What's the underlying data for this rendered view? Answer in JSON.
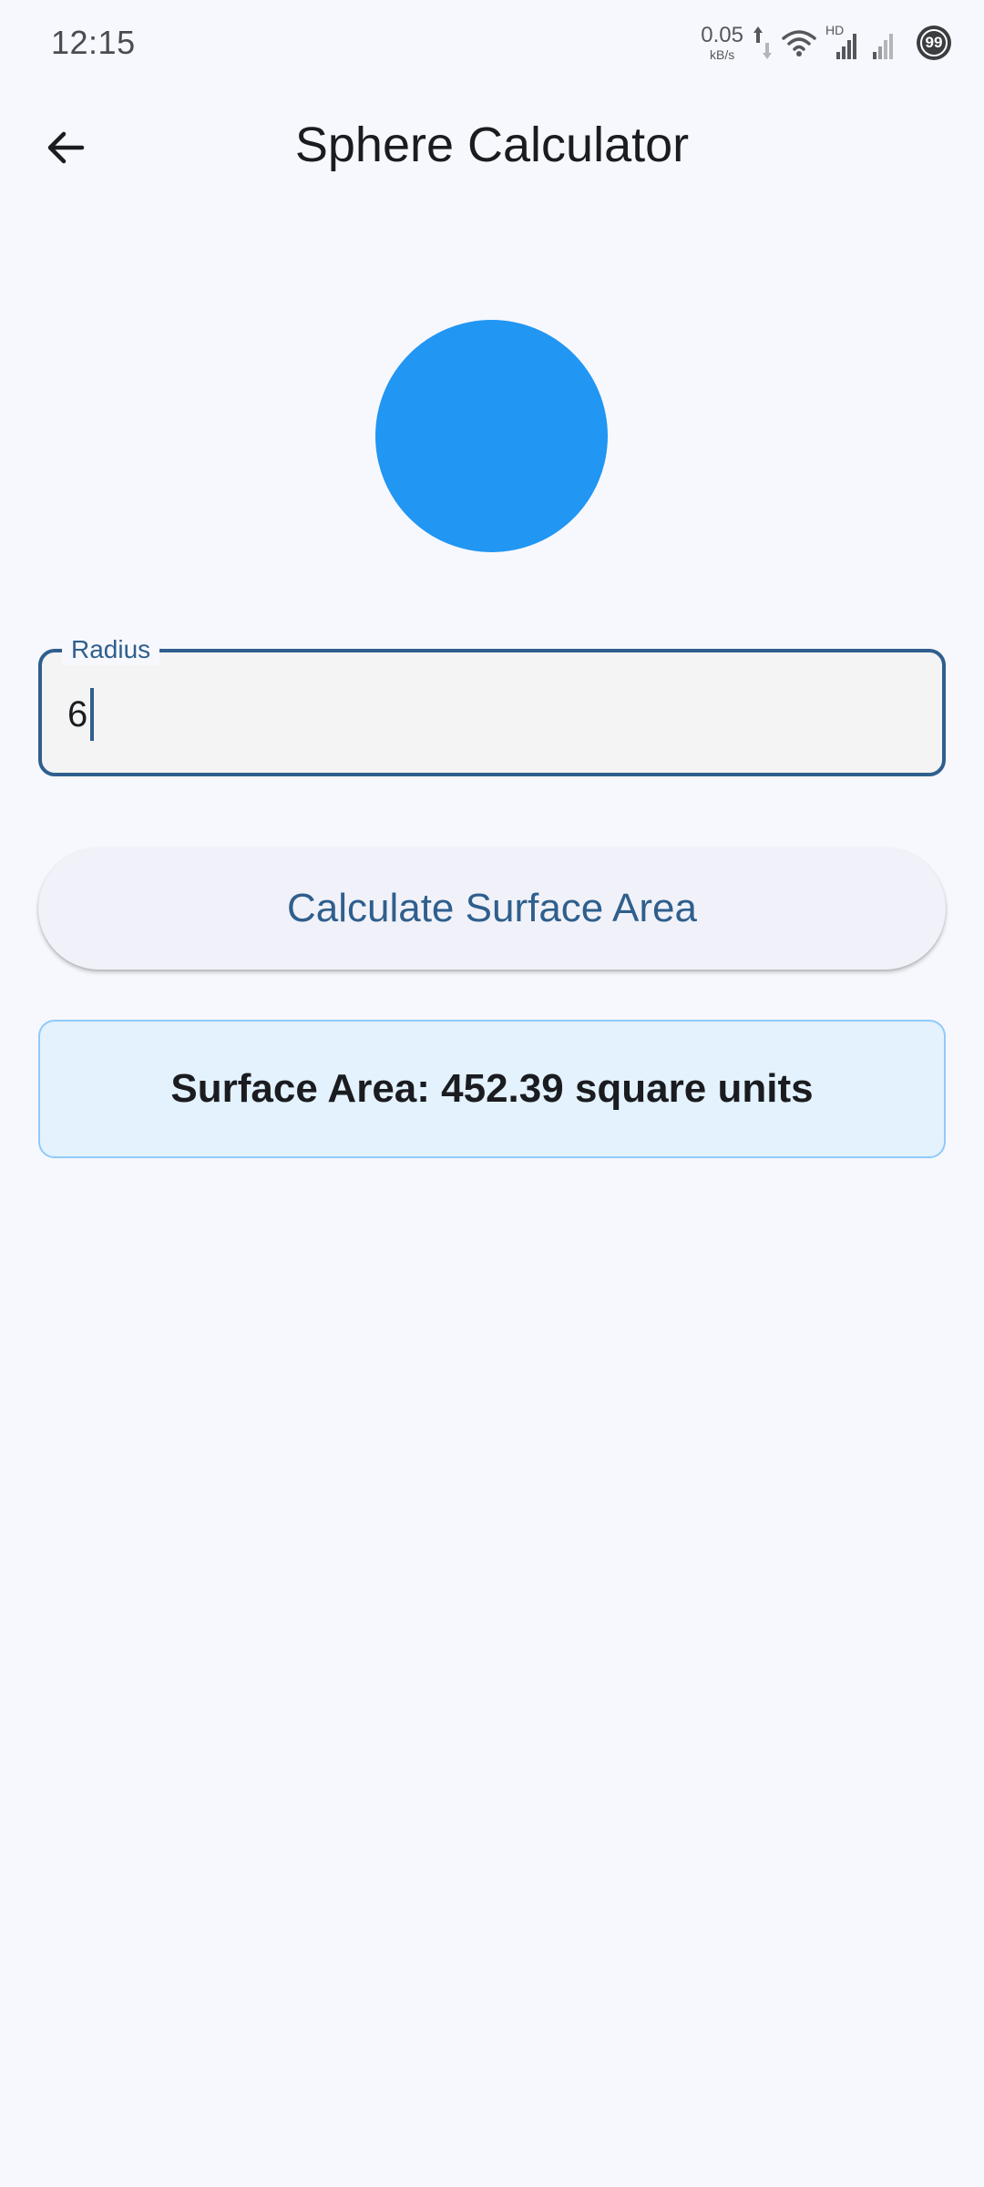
{
  "status_bar": {
    "time": "12:15",
    "net_speed_value": "0.05",
    "net_speed_unit": "kB/s",
    "hd_label": "HD",
    "battery": "99"
  },
  "app_bar": {
    "title": "Sphere Calculator",
    "back_icon": "arrow-back-icon"
  },
  "sphere": {
    "color": "#2196f3"
  },
  "radius_field": {
    "label": "Radius",
    "value": "6"
  },
  "calculate_button": {
    "label": "Calculate Surface Area"
  },
  "result": {
    "text": "Surface Area: 452.39 square units"
  },
  "colors": {
    "background": "#f7f8fd",
    "primary": "#2f5f8d",
    "result_bg": "#e3f2fd",
    "result_border": "#90caf9"
  }
}
